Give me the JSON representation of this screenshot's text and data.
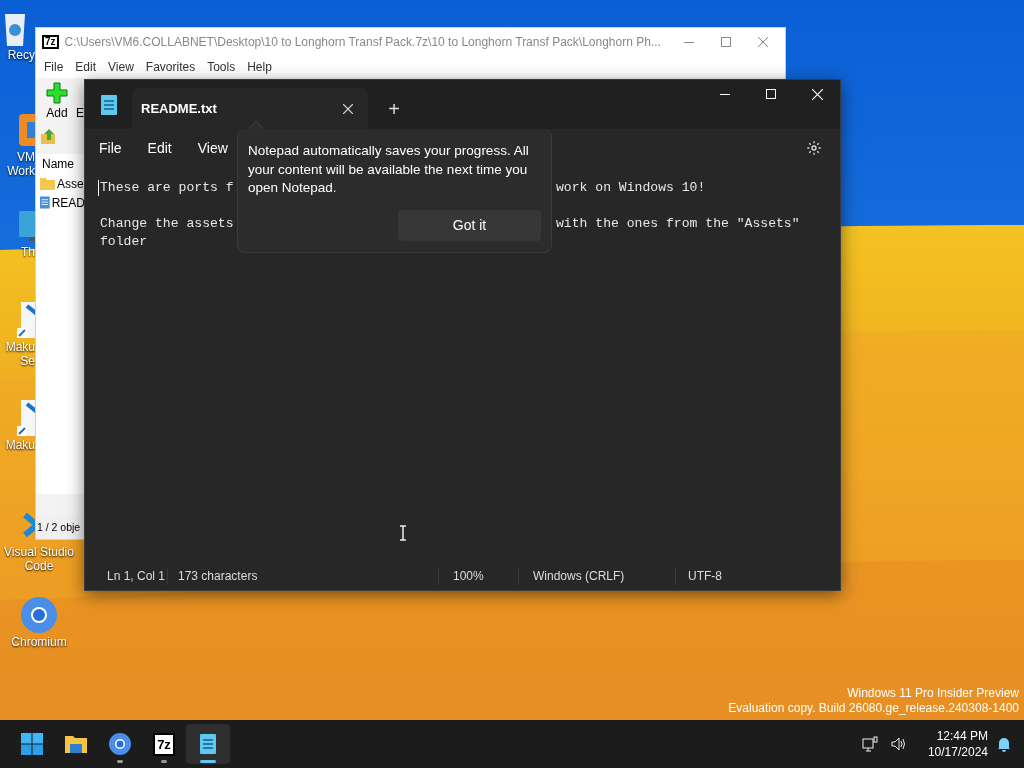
{
  "desktop_icons": [
    {
      "kind": "recycle",
      "label_lines": [
        "Recy"
      ]
    },
    {
      "kind": "vmware",
      "label_lines": [
        "VM",
        "Work"
      ]
    },
    {
      "kind": "monitor",
      "label_lines": [
        "Th"
      ]
    },
    {
      "kind": "maku",
      "label_lines": [
        "Maku",
        "Se"
      ]
    },
    {
      "kind": "maku",
      "label_lines": [
        "Maku"
      ]
    },
    {
      "kind": "vscode",
      "label_lines": [
        "Visual Studio",
        "Code"
      ]
    },
    {
      "kind": "chromium",
      "label_lines": [
        "Chromium"
      ]
    }
  ],
  "archive_window": {
    "logo": "7z",
    "title": "C:\\Users\\VM6.COLLABNET\\Desktop\\10 to Longhorn Transf Pack.7z\\10 to Longhorn Transf Pack\\Longhorn Ph...",
    "menu": [
      "File",
      "Edit",
      "View",
      "Favorites",
      "Tools",
      "Help"
    ],
    "toolbar": [
      "Add",
      "E"
    ],
    "column": "Name",
    "rows": [
      {
        "kind": "folder",
        "name": "Asse"
      },
      {
        "kind": "file",
        "name": "READ"
      }
    ],
    "status": "1 / 2 obje"
  },
  "notepad": {
    "tabs": [
      {
        "title": "README.txt",
        "selected": true
      }
    ],
    "new_tab": "+",
    "menu": [
      "File",
      "Edit",
      "View"
    ],
    "paragraphs": [
      {
        "lines": [
          {
            "left": "These are ports f",
            "right": "work on Windows 10!"
          }
        ]
      },
      {
        "lines": [
          {
            "left": "Change the assets",
            "right": "with the ones from the \"Assets\""
          },
          {
            "left": "folder"
          }
        ]
      }
    ],
    "popup": {
      "message": "Notepad automatically saves your progress. All your content will be available the next time you open Notepad.",
      "button": "Got it"
    },
    "status_bar": [
      "Ln 1, Col 1",
      "173 characters",
      "100%",
      "Windows (CRLF)",
      "UTF-8"
    ]
  },
  "watermark": [
    "Windows 11 Pro Insider Preview",
    "Evaluation copy. Build 26080.ge_release.240308-1400"
  ],
  "taskbar": {
    "apps": [
      {
        "kind": "start",
        "running": false,
        "active": false
      },
      {
        "kind": "explorer",
        "running": false,
        "active": false
      },
      {
        "kind": "chromium",
        "running": true,
        "active": false
      },
      {
        "kind": "sevenzip",
        "label": "7z",
        "running": true,
        "active": false
      },
      {
        "kind": "notepad",
        "running": true,
        "active": true
      }
    ],
    "time": "12:44 PM",
    "date": "10/17/2024"
  }
}
